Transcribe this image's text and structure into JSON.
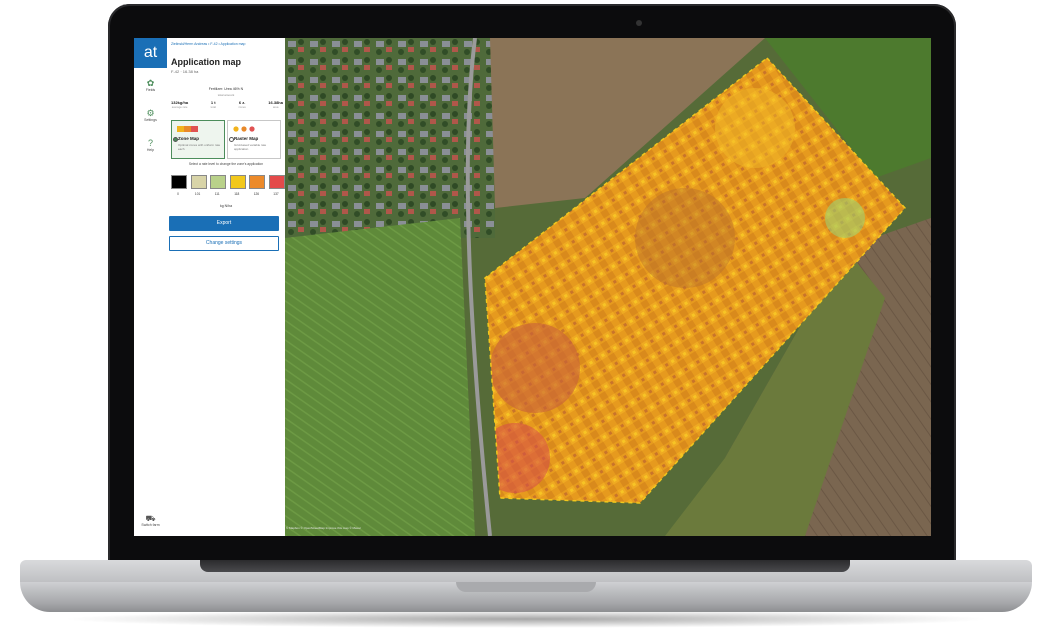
{
  "app": {
    "logo": "at",
    "breadcrumb": "Zielinski/Herrn Andreas • F-42 • Application map",
    "title": "Application map",
    "subtitle": "F-42 · 16.38 ha"
  },
  "nav": {
    "items": [
      {
        "icon": "sprout-icon",
        "glyph": "✿",
        "label": "Fields"
      },
      {
        "icon": "gear-icon",
        "glyph": "⚙",
        "label": "Settings"
      },
      {
        "icon": "help-icon",
        "glyph": "?",
        "label": "Help"
      }
    ],
    "bottom": {
      "icon": "tractor-icon",
      "glyph": "⛟",
      "label": "Switch farm"
    }
  },
  "panel": {
    "stats_title": "Fertilizer: Urea 46% N",
    "stats_sub": "total amount",
    "stats": [
      {
        "value": "132kg/ha",
        "label": "average rate"
      },
      {
        "value": "1 t",
        "label": "total"
      },
      {
        "value": "6 z.",
        "label": "zones"
      },
      {
        "value": "16.38ha",
        "label": "area"
      }
    ],
    "options": [
      {
        "title": "Zone Map",
        "desc": "Optimal zones with uniform rate each",
        "selected": true,
        "swatches": [
          "#f2b31c",
          "#e8892a",
          "#e05252"
        ]
      },
      {
        "title": "Raster Map",
        "desc": "Grid-based variable rate application",
        "selected": false,
        "swatches": [
          "#f2b31c",
          "#e8892a",
          "#e05252"
        ]
      }
    ],
    "rate_help": "Select a rate level to change the zone's application",
    "rates": [
      {
        "value": "0",
        "color": "#000000"
      },
      {
        "value": "101",
        "color": "#d8d4a8"
      },
      {
        "value": "111",
        "color": "#b9d18a"
      },
      {
        "value": "118",
        "color": "#f2c81c"
      },
      {
        "value": "126",
        "color": "#ec8a2a"
      },
      {
        "value": "137",
        "color": "#e44a4a"
      }
    ],
    "unit": "kg N/ha",
    "export_label": "Export",
    "change_label": "Change settings"
  },
  "map": {
    "credit": "© Mapbox © OpenStreetMap Improve this map © Maxar"
  }
}
